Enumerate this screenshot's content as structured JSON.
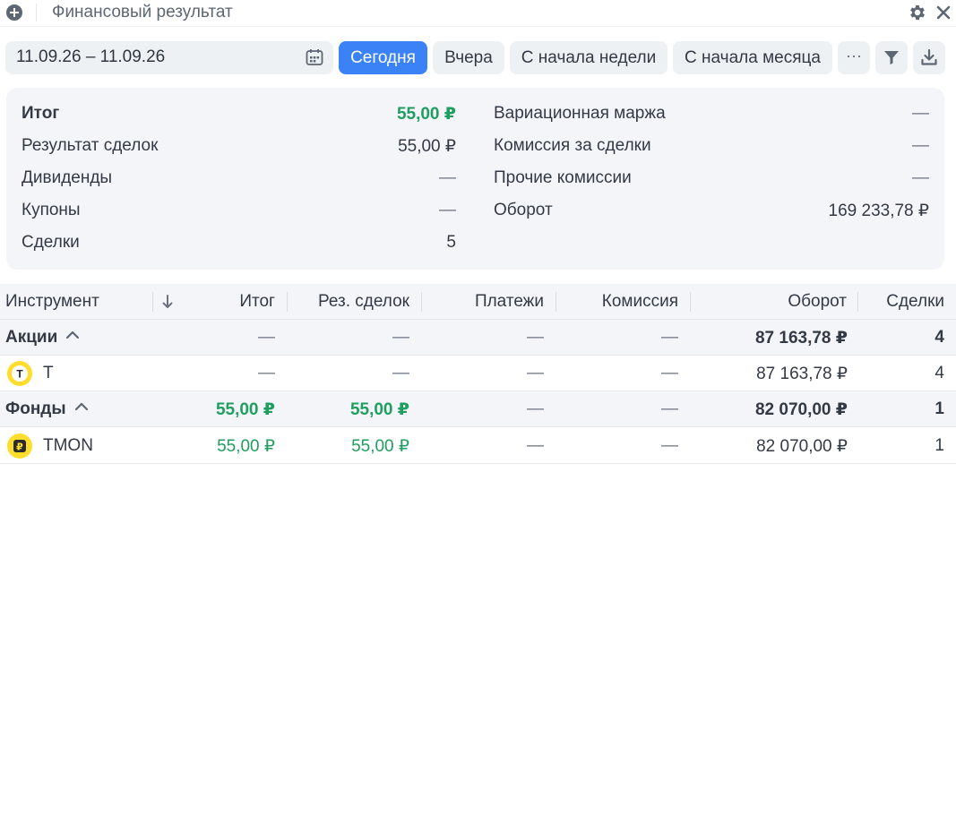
{
  "window": {
    "title": "Финансовый результат",
    "add_icon": "plus-circle-icon",
    "settings_icon": "gear-icon",
    "close_icon": "close-icon"
  },
  "toolbar": {
    "date_range": "11.09.26 – 11.09.26",
    "calendar_icon": "calendar-icon",
    "presets": [
      {
        "label": "Сегодня",
        "active": true
      },
      {
        "label": "Вчера",
        "active": false
      },
      {
        "label": "С начала недели",
        "active": false
      },
      {
        "label": "С начала месяца",
        "active": false
      }
    ],
    "more_label": "···",
    "filter_icon": "filter-icon",
    "download_icon": "download-icon"
  },
  "summary": {
    "left": [
      {
        "label": "Итог",
        "value": "55,00 ₽"
      },
      {
        "label": "Результат сделок",
        "value": "55,00 ₽"
      },
      {
        "label": "Дивиденды",
        "value": "—"
      },
      {
        "label": "Купоны",
        "value": "—"
      },
      {
        "label": "Сделки",
        "value": "5"
      }
    ],
    "right": [
      {
        "label": "Вариационная маржа",
        "value": "—"
      },
      {
        "label": "Комиссия за сделки",
        "value": "—"
      },
      {
        "label": "Прочие комиссии",
        "value": "—"
      },
      {
        "label": "Оборот",
        "value": "169 233,78 ₽"
      }
    ]
  },
  "table": {
    "columns": [
      "Инструмент",
      "Итог",
      "Рез. сделок",
      "Платежи",
      "Комиссия",
      "Оборот",
      "Сделки"
    ],
    "sort_icon": "arrow-down-icon",
    "rows": [
      {
        "type": "group",
        "name": "Акции",
        "itog": "—",
        "res": "—",
        "pay": "—",
        "com": "—",
        "turnover": "87 163,78 ₽",
        "deals": "4"
      },
      {
        "type": "item",
        "name": "T",
        "icon_label": "T",
        "itog": "—",
        "res": "—",
        "pay": "—",
        "com": "—",
        "turnover": "87 163,78 ₽",
        "deals": "4"
      },
      {
        "type": "group",
        "name": "Фонды",
        "itog": "55,00 ₽",
        "res": "55,00 ₽",
        "pay": "—",
        "com": "—",
        "turnover": "82 070,00 ₽",
        "deals": "1"
      },
      {
        "type": "item",
        "name": "TMON",
        "icon_label": "₽",
        "itog": "55,00 ₽",
        "res": "55,00 ₽",
        "pay": "—",
        "com": "—",
        "turnover": "82 070,00 ₽",
        "deals": "1"
      }
    ]
  },
  "colors": {
    "accent": "#3b82f6",
    "positive": "#1f9e5f",
    "panel": "#f3f5f8",
    "chip": "#eef1f4",
    "tinkoff_yellow": "#ffdd2d"
  }
}
